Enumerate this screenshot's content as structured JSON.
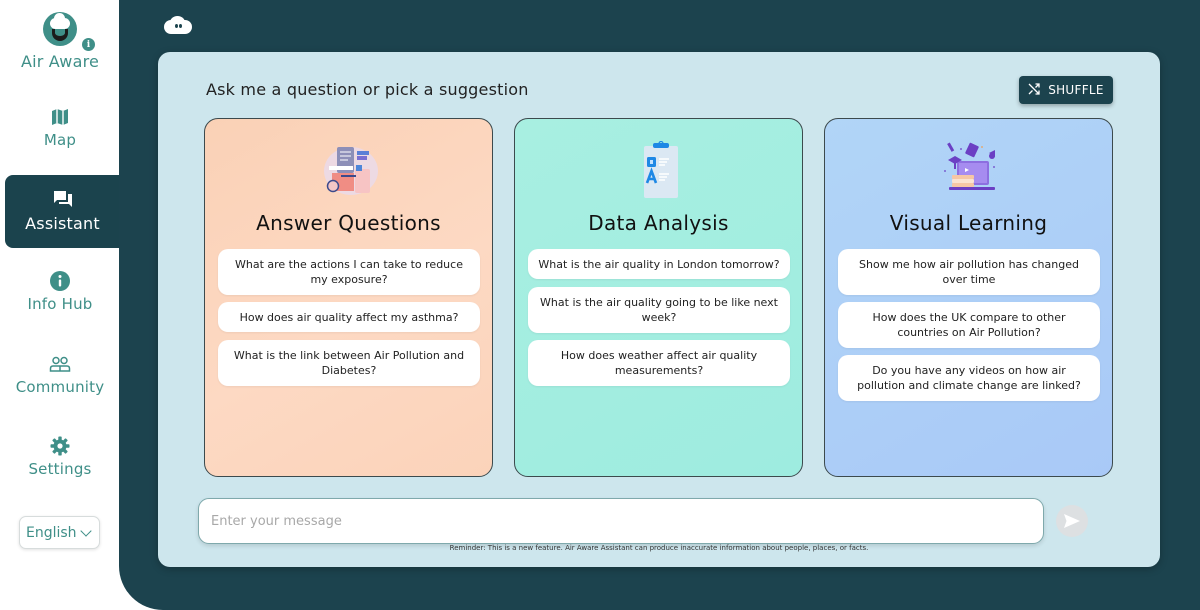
{
  "sidebar": {
    "brand_label": "Air Aware",
    "items": [
      {
        "label": "Map",
        "icon": "map-icon"
      },
      {
        "label": "Assistant",
        "icon": "chat-icon",
        "active": true
      },
      {
        "label": "Info Hub",
        "icon": "info-icon"
      },
      {
        "label": "Community",
        "icon": "people-icon"
      },
      {
        "label": "Settings",
        "icon": "gear-icon"
      }
    ],
    "language": "English"
  },
  "colors": {
    "primary": "#1c434e",
    "accent": "#3f8f88",
    "panel": "#cde6ed",
    "card_answer": "#fdd6bf",
    "card_data": "#a3eee0",
    "card_visual": "#add0f7"
  },
  "main": {
    "prompt_title": "Ask me a question or pick a suggestion",
    "shuffle_label": "SHUFFLE",
    "cards": [
      {
        "title": "Answer Questions",
        "illustration": "document-search-illustration",
        "suggestions": [
          "What are the actions I can take to reduce my exposure?",
          "How does air quality affect my asthma?",
          "What is the link between Air Pollution and Diabetes?"
        ]
      },
      {
        "title": "Data Analysis",
        "illustration": "clipboard-qa-illustration",
        "suggestions": [
          "What is the air quality in London tomorrow?",
          "What is the air quality going to be like next week?",
          "How does weather affect air quality measurements?"
        ]
      },
      {
        "title": "Visual Learning",
        "illustration": "laptop-learning-illustration",
        "suggestions": [
          "Show me how air pollution has changed over time",
          "How does the UK compare to other countries on Air Pollution?",
          "Do you have any videos on how air pollution and climate change are linked?"
        ]
      }
    ],
    "input": {
      "placeholder": "Enter your message",
      "value": ""
    },
    "reminder": "Reminder: This is a new feature. Air Aware Assistant can produce inaccurate information about people, places, or facts."
  }
}
